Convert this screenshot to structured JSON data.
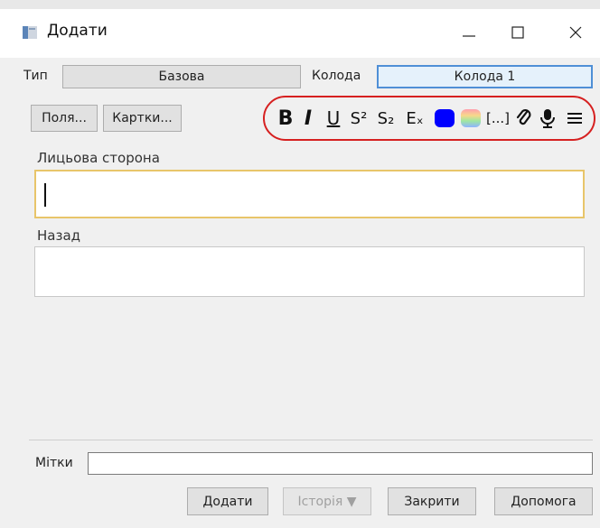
{
  "window": {
    "title": "Додати"
  },
  "type_row": {
    "type_label": "Тип",
    "type_value": "Базова",
    "deck_label": "Колода",
    "deck_value": "Колода 1"
  },
  "buttons_row": {
    "fields_label": "Поля...",
    "cards_label": "Картки..."
  },
  "toolbar": {
    "bold": "B",
    "italic": "I",
    "underline": "U",
    "superscript": "S²",
    "subscript": "S₂",
    "clear_format": "Eₓ",
    "cloze": "[...]",
    "accent_color": "#0000ff"
  },
  "fields": [
    {
      "label": "Лицьова сторона",
      "value": ""
    },
    {
      "label": "Назад",
      "value": ""
    }
  ],
  "tags": {
    "label": "Мітки",
    "value": ""
  },
  "footer": {
    "add": "Додати",
    "history": "Історія ▼",
    "close": "Закрити",
    "help": "Допомога"
  }
}
